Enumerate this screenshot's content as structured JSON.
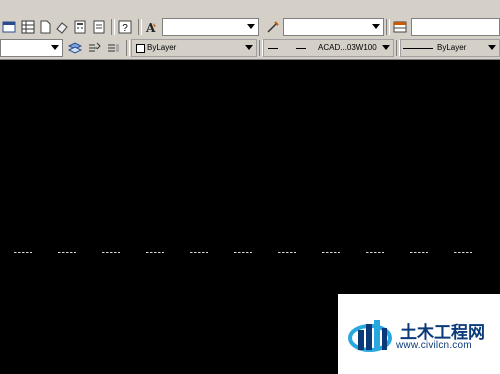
{
  "properties_toolbar": {
    "color_value": "ByLayer",
    "linetype_value": "ACAD...03W100",
    "lineweight_value": "ByLayer"
  },
  "icons": [
    "layer-properties-icon",
    "layer-state-icon",
    "layer-previous-icon",
    "match-properties-icon",
    "properties-icon",
    "help-icon",
    "text-style-icon",
    "dimension-style-icon",
    "table-style-icon",
    "layer-manager-icon",
    "layer-walk-icon",
    "layer-tools-icon"
  ],
  "watermark": {
    "title": "土木工程网",
    "url": "www.civilcn.com",
    "colors": {
      "primary": "#0b3a78",
      "accent": "#29a7df"
    }
  },
  "canvas": {
    "background": "#000000",
    "dash_color": "#dcdcdc"
  }
}
